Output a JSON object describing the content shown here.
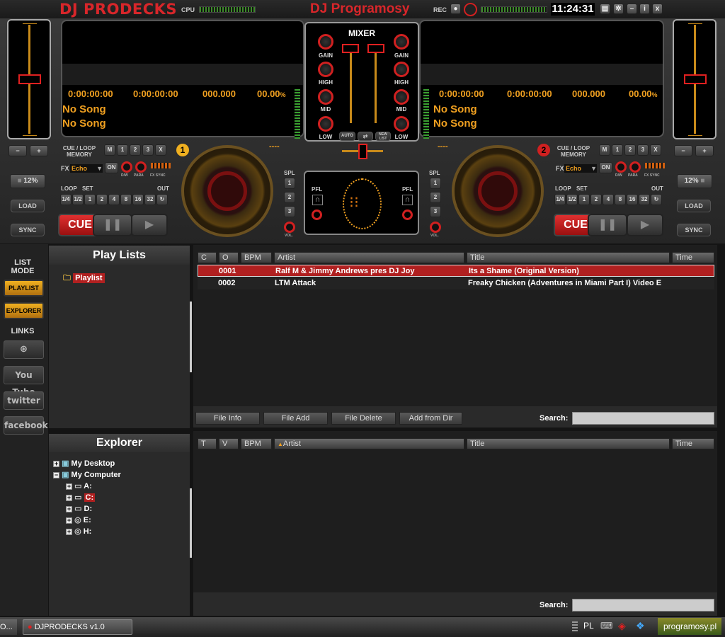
{
  "app": {
    "logo": "DJ PRODECKS",
    "title": "DJ Programosy",
    "clock": "11:24:31",
    "cpu_label": "CPU",
    "rec_label": "REC"
  },
  "deck1": {
    "number": "1",
    "time_elapsed": "0:00:00:00",
    "time_remain": "0:00:00:00",
    "bpm": "000.000",
    "pitch_pct": "00.00",
    "pct_sign": "%",
    "song1": "No Song",
    "song2": "No Song",
    "pitch_range": "12%",
    "cue_loop_label": "CUE / LOOP",
    "memory_label": "MEMORY",
    "fx_label": "FX",
    "fx_value": "Echo",
    "fx_on": "ON",
    "dw": "D/W",
    "para": "PARA",
    "fxsync": "FX SYNC",
    "loop_label": "LOOP",
    "set_label": "SET",
    "out_label": "OUT",
    "cue": "CUE",
    "load": "LOAD",
    "sync": "SYNC",
    "dashes": "----"
  },
  "deck2": {
    "number": "2",
    "time_elapsed": "0:00:00:00",
    "time_remain": "0:00:00:00",
    "bpm": "000.000",
    "pitch_pct": "00.00",
    "pct_sign": "%",
    "song1": "No Song",
    "song2": "No Song",
    "pitch_range": "12%",
    "cue_loop_label": "CUE / LOOP",
    "memory_label": "MEMORY",
    "fx_label": "FX",
    "fx_value": "Echo",
    "fx_on": "ON",
    "dw": "D/W",
    "para": "PARA",
    "fxsync": "FX SYNC",
    "loop_label": "LOOP",
    "set_label": "SET",
    "out_label": "OUT",
    "cue": "CUE",
    "load": "LOAD",
    "sync": "SYNC",
    "dashes": "----"
  },
  "memory_buttons": [
    "M",
    "1",
    "2",
    "3",
    "X"
  ],
  "loop_buttons": [
    "1/4",
    "1/2",
    "1",
    "2",
    "4",
    "8",
    "16",
    "32"
  ],
  "mixer": {
    "title": "MIXER",
    "gain": "GAIN",
    "high": "HIGH",
    "mid": "MID",
    "low": "LOW",
    "auto": "AUTO",
    "newlist": "NEW LIST"
  },
  "center": {
    "spl": "SPL",
    "pfl": "PFL",
    "vol": "VOL.",
    "spl_buttons": [
      "1",
      "2",
      "3"
    ]
  },
  "sidebar": {
    "list_mode": "LIST MODE",
    "playlist": "PLAYLIST",
    "explorer": "EXPLORER",
    "links": "LINKS",
    "youtube": "You Tube",
    "twitter": "twitter",
    "facebook": "facebook"
  },
  "playlists": {
    "title": "Play Lists",
    "items": [
      "Playlist"
    ]
  },
  "tracks": {
    "columns": [
      "C",
      "O",
      "BPM",
      "Artist",
      "Title",
      "Time"
    ],
    "rows": [
      {
        "o": "0001",
        "artist": "Ralf M & Jimmy Andrews pres DJ Joy",
        "title": "Its a Shame (Original Version)"
      },
      {
        "o": "0002",
        "artist": "LTM Attack",
        "title": "Freaky Chicken (Adventures in Miami Part I) Video E"
      }
    ],
    "buttons": [
      "File Info",
      "File Add",
      "File Delete",
      "Add from Dir"
    ],
    "search_label": "Search:"
  },
  "explorer": {
    "title": "Explorer",
    "items": [
      "My Desktop",
      "My Computer",
      "A:",
      "C:",
      "D:",
      "E:",
      "H:"
    ],
    "columns": [
      "T",
      "V",
      "BPM",
      "Artist",
      "Title",
      "Time"
    ],
    "search_label": "Search:"
  },
  "taskbar": {
    "left_text": "O...",
    "task": "DJPRODECKS v1.0",
    "lang": "PL",
    "brand": "programosy.pl"
  }
}
